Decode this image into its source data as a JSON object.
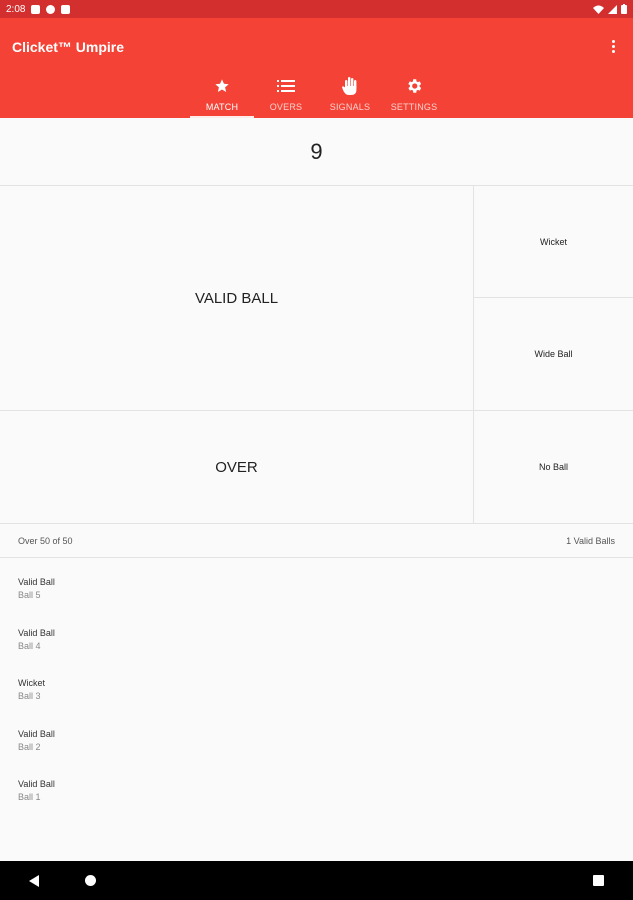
{
  "status_bar": {
    "time": "2:08"
  },
  "app_bar": {
    "title": "Clicket™ Umpire"
  },
  "tabs": [
    {
      "label": "MATCH",
      "icon": "star-icon",
      "active": true
    },
    {
      "label": "OVERS",
      "icon": "list-icon",
      "active": false
    },
    {
      "label": "SIGNALS",
      "icon": "hand-icon",
      "active": false
    },
    {
      "label": "SETTINGS",
      "icon": "gear-icon",
      "active": false
    }
  ],
  "score": "9",
  "buttons": {
    "valid_ball": "VALID BALL",
    "over": "OVER",
    "wicket": "Wicket",
    "wide_ball": "Wide Ball",
    "no_ball": "No Ball"
  },
  "summary": {
    "over": "Over 50 of 50",
    "valid_balls": "1 Valid Balls"
  },
  "balls": [
    {
      "type": "Valid Ball",
      "ball": "Ball 5"
    },
    {
      "type": "Valid Ball",
      "ball": "Ball 4"
    },
    {
      "type": "Wicket",
      "ball": "Ball 3"
    },
    {
      "type": "Valid Ball",
      "ball": "Ball 2"
    },
    {
      "type": "Valid Ball",
      "ball": "Ball 1"
    }
  ],
  "colors": {
    "app_bar": "#f44336",
    "status_bar": "#d32f2f"
  }
}
